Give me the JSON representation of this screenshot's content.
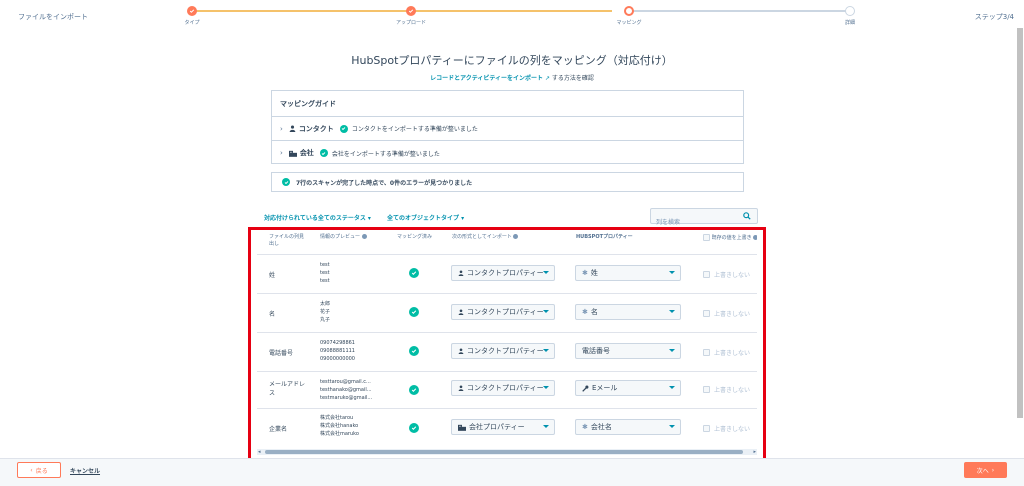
{
  "header": {
    "title": "ファイルをインポート",
    "step_indicator": "ステップ3/4"
  },
  "stepper": {
    "steps": [
      {
        "label": "タイプ",
        "state": "done"
      },
      {
        "label": "アップロード",
        "state": "done"
      },
      {
        "label": "マッピング",
        "state": "current"
      },
      {
        "label": "詳細",
        "state": "todo"
      }
    ]
  },
  "page": {
    "title": "HubSpotプロパティーにファイルの列をマッピング（対応付け）",
    "sub_link": "レコードとアクティビティーをインポート",
    "sub_text": "する方法を確認"
  },
  "guide": {
    "title": "マッピングガイド",
    "rows": [
      {
        "name": "コンタクト",
        "status": "コンタクトをインポートする準備が整いました",
        "icon": "person-icon"
      },
      {
        "name": "会社",
        "status": "会社をインポートする準備が整いました",
        "icon": "building-icon"
      }
    ]
  },
  "scan": {
    "text": "7行のスキャンが完了した時点で、0件のエラーが見つかりました"
  },
  "filters": {
    "status": "対応付けられている全てのステータス",
    "object": "全てのオブジェクトタイプ",
    "search_placeholder": "列を検索"
  },
  "table": {
    "headers": {
      "col1": "ファイルの列見出し",
      "col2": "情報のプレビュー",
      "col3": "マッピング済み",
      "col4": "次の形式としてインポート",
      "col5": "HUBSPOTプロパティー",
      "col6": "既存の値を上書き"
    },
    "overwrite_label": "上書きしない",
    "rows": [
      {
        "name": "姓",
        "preview": [
          "test",
          "test",
          "test"
        ],
        "type": "コンタクトプロパティー",
        "prop": "姓"
      },
      {
        "name": "名",
        "preview": [
          "太郎",
          "花子",
          "丸子"
        ],
        "type": "コンタクトプロパティー",
        "prop": "名"
      },
      {
        "name": "電話番号",
        "preview": [
          "09074298861",
          "09088881111",
          "09000000000"
        ],
        "type": "コンタクトプロパティー",
        "prop": "電話番号"
      },
      {
        "name": "メールアドレス",
        "preview": [
          "testtarou@gmail.c...",
          "testhanako@gmail...",
          "testmaruko@gmail..."
        ],
        "type": "コンタクトプロパティー",
        "prop": "Eメール"
      },
      {
        "name": "企業名",
        "preview": [
          "株式会社tarou",
          "株式会社hanako",
          "株式会社maruko"
        ],
        "type": "会社プロパティー",
        "prop": "会社名"
      }
    ]
  },
  "footer": {
    "back": "戻る",
    "cancel": "キャンセル",
    "next": "次へ"
  },
  "colors": {
    "accent": "#ff7a59",
    "link": "#0091ae",
    "success": "#00bda5",
    "highlight": "#e60012"
  }
}
